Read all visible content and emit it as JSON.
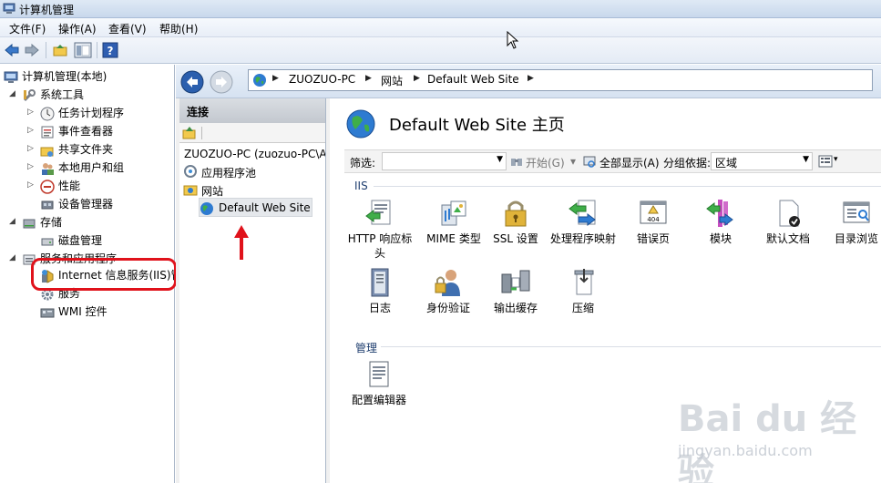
{
  "window": {
    "title": "计算机管理"
  },
  "menu": [
    "文件(F)",
    "操作(A)",
    "查看(V)",
    "帮助(H)"
  ],
  "tree": {
    "root": "计算机管理(本地)",
    "system_tools": "系统工具",
    "task_scheduler": "任务计划程序",
    "event_viewer": "事件查看器",
    "shared_folders": "共享文件夹",
    "local_users": "本地用户和组",
    "performance": "性能",
    "device_manager": "设备管理器",
    "storage": "存储",
    "disk_management": "磁盘管理",
    "services_apps": "服务和应用程序",
    "iis": "Internet 信息服务(IIS)管",
    "services": "服务",
    "wmi": "WMI 控件"
  },
  "address": {
    "machine": "ZUOZUO-PC",
    "sites": "网站",
    "site": "Default Web Site"
  },
  "connections": {
    "header": "连接",
    "server": "ZUOZUO-PC (zuozuo-PC\\A",
    "app_pools": "应用程序池",
    "sites": "网站",
    "default_site": "Default Web Site"
  },
  "main": {
    "heading": "Default Web Site 主页",
    "filter_label": "筛选:",
    "start_label": "开始(G)",
    "show_all_label": "全部显示(A)",
    "group_by_label": "分组依据:",
    "group_by_value": "区域",
    "iis_section": "IIS",
    "manage_section": "管理",
    "features": [
      {
        "label": "HTTP 响应标头",
        "icon": "http-headers-icon"
      },
      {
        "label": "MIME 类型",
        "icon": "mime-types-icon"
      },
      {
        "label": "SSL 设置",
        "icon": "ssl-lock-icon"
      },
      {
        "label": "处理程序映射",
        "icon": "handler-mappings-icon"
      },
      {
        "label": "错误页",
        "icon": "error-pages-icon"
      },
      {
        "label": "模块",
        "icon": "modules-icon"
      },
      {
        "label": "默认文档",
        "icon": "default-document-icon"
      },
      {
        "label": "目录浏览",
        "icon": "directory-browsing-icon"
      },
      {
        "label": "日志",
        "icon": "logging-icon"
      },
      {
        "label": "身份验证",
        "icon": "authentication-icon"
      },
      {
        "label": "输出缓存",
        "icon": "output-cache-icon"
      },
      {
        "label": "压缩",
        "icon": "compression-icon"
      }
    ],
    "manage_features": [
      {
        "label": "配置编辑器",
        "icon": "configuration-editor-icon"
      }
    ],
    "error_page_code": "404"
  },
  "watermark": {
    "brand": "Bai du 经验",
    "url": "jingyan.baidu.com"
  },
  "colors": {
    "highlight": "#e0121b",
    "section_title": "#1f3e6f"
  }
}
